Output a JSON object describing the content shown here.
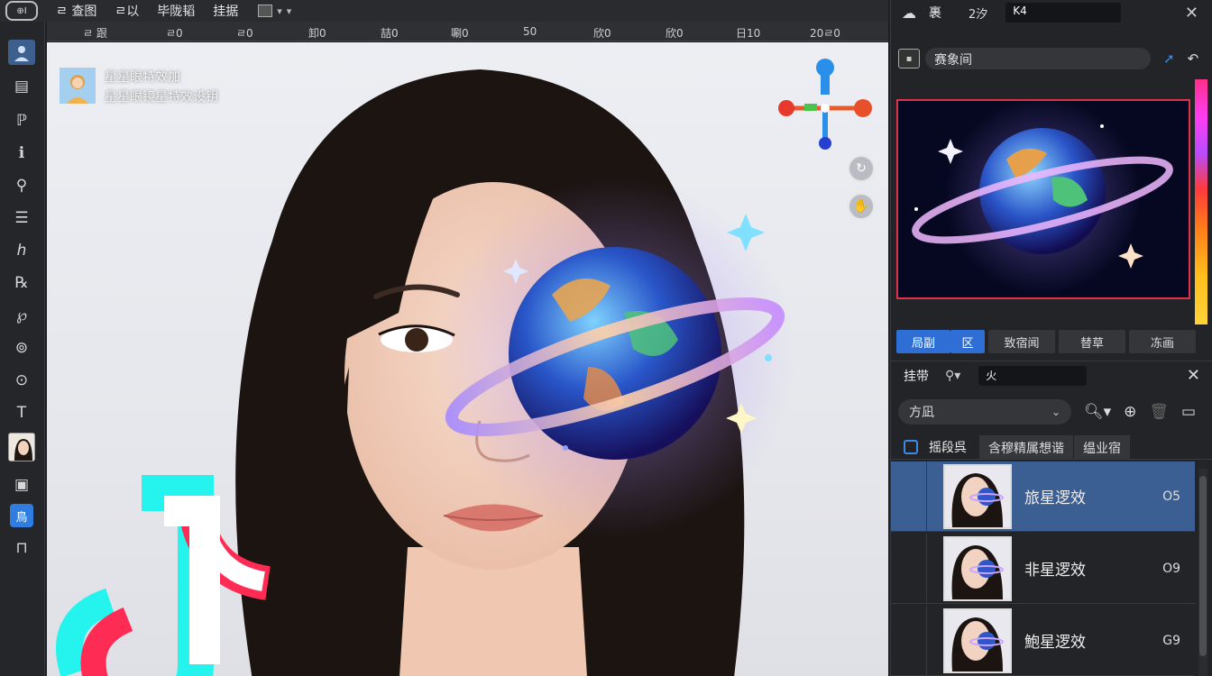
{
  "menubar": {
    "logo": "⊕I",
    "items": [
      "ㄹ 查图",
      "ㄹ以",
      "毕陇韬",
      "挂据"
    ],
    "dropdown": "▾"
  },
  "ruler": {
    "ticks": [
      "ㄹ 跟",
      "ㄹ0",
      "ㄹ0",
      "卸0",
      "喆0",
      "唰0",
      "50",
      "欣0",
      "欣0",
      "日10",
      "20ㄹ0"
    ]
  },
  "toolbar": {
    "tools": [
      "⌂",
      "▤",
      "ℙ",
      "ℹ",
      "⚲",
      "☰",
      "ℎ",
      "℞",
      "℘",
      "⊚",
      "⊙",
      "T",
      "☺",
      "▣",
      "鳥",
      "⊓"
    ]
  },
  "canvas": {
    "badge_line1": "星星眼特效加",
    "badge_line2": "星星眼镜星特效设钥"
  },
  "right_panel": {
    "top_icon": "☁",
    "top_title": "裹",
    "top_label": "2汐",
    "top_field": "K4",
    "close": "✕",
    "search_value": "赛象间",
    "tabs": [
      "局副",
      "区",
      "致宿闻",
      "替草",
      "冻画"
    ],
    "section_title": "挂带",
    "section_field": "火",
    "filter_select": "方凪",
    "column_name": "摇段呉",
    "column_b": "含穆精属想谐",
    "column_c": "缊业宿",
    "layers": [
      {
        "name": "旅星逻效",
        "value": "O5",
        "selected": true
      },
      {
        "name": "非星逻效",
        "value": "O9",
        "selected": false
      },
      {
        "name": "鮑星逻效",
        "value": "G9",
        "selected": false
      }
    ]
  }
}
